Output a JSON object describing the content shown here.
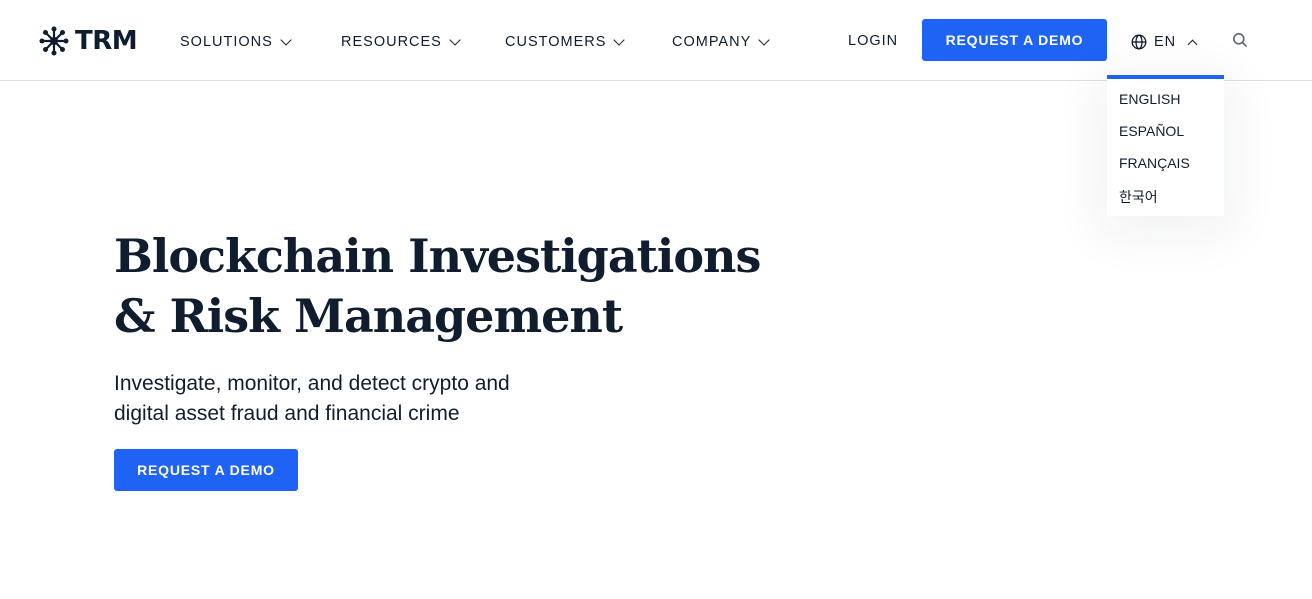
{
  "brand": {
    "name": "TRM",
    "logo_icon": "network-node-icon"
  },
  "nav": {
    "items": [
      {
        "label": "SOLUTIONS"
      },
      {
        "label": "RESOURCES"
      },
      {
        "label": "CUSTOMERS"
      },
      {
        "label": "COMPANY"
      }
    ],
    "login_label": "LOGIN",
    "cta_label": "REQUEST A DEMO",
    "language": "EN",
    "search_icon": "search-icon"
  },
  "language_menu": {
    "options": [
      "ENGLISH",
      "ESPAÑOL",
      "FRANÇAIS",
      "한국어"
    ]
  },
  "hero": {
    "title_line1": "Blockchain Investigations",
    "title_line2": "& Risk Management",
    "subtitle_line1": "Investigate, monitor, and detect crypto and",
    "subtitle_line2": "digital asset fraud and financial crime",
    "cta_label": "REQUEST A DEMO"
  },
  "colors": {
    "accent": "#1f63f5",
    "text": "#0f1d2e",
    "divider": "#dcdfe3"
  }
}
